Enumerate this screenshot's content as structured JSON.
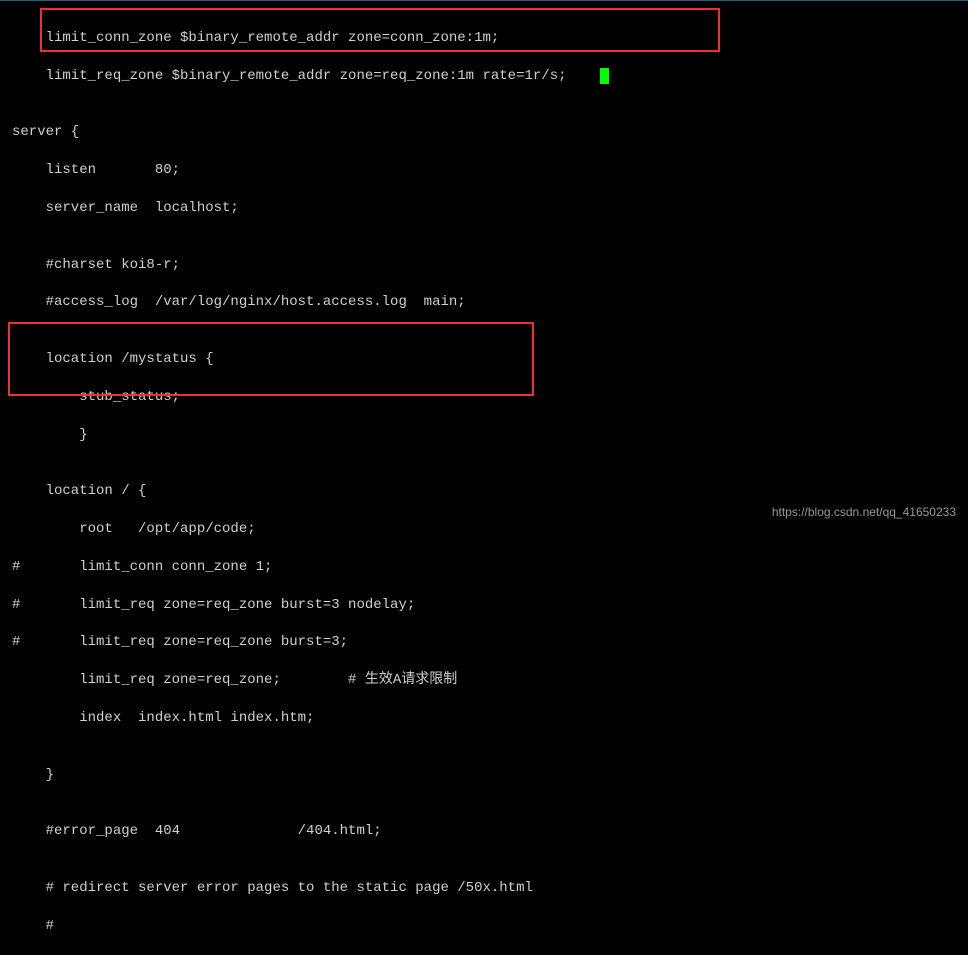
{
  "code": {
    "l1": "    limit_conn_zone $binary_remote_addr zone=conn_zone:1m;",
    "l2": "    limit_req_zone $binary_remote_addr zone=req_zone:1m rate=1r/s;    ",
    "l3": "",
    "l4": "server {",
    "l5": "    listen       80;",
    "l6": "    server_name  localhost;",
    "l7": "",
    "l8": "    #charset koi8-r;",
    "l9": "    #access_log  /var/log/nginx/host.access.log  main;",
    "l10": "",
    "l11": "    location /mystatus {",
    "l12": "        stub_status;",
    "l13": "        }",
    "l14": "",
    "l15": "    location / {",
    "l16": "        root   /opt/app/code;",
    "l17": "#       limit_conn conn_zone 1;",
    "l18": "#       limit_req zone=req_zone burst=3 nodelay;",
    "l19": "#       limit_req zone=req_zone burst=3;",
    "l20": "        limit_req zone=req_zone;        # 生效A请求限制",
    "l21": "        index  index.html index.htm;",
    "l22": "",
    "l23": "    }",
    "l24": "",
    "l25": "    #error_page  404              /404.html;",
    "l26": "",
    "l27": "    # redirect server error pages to the static page /50x.html",
    "l28": "    #"
  },
  "watermark": "https://blog.csdn.net/qq_41650233"
}
